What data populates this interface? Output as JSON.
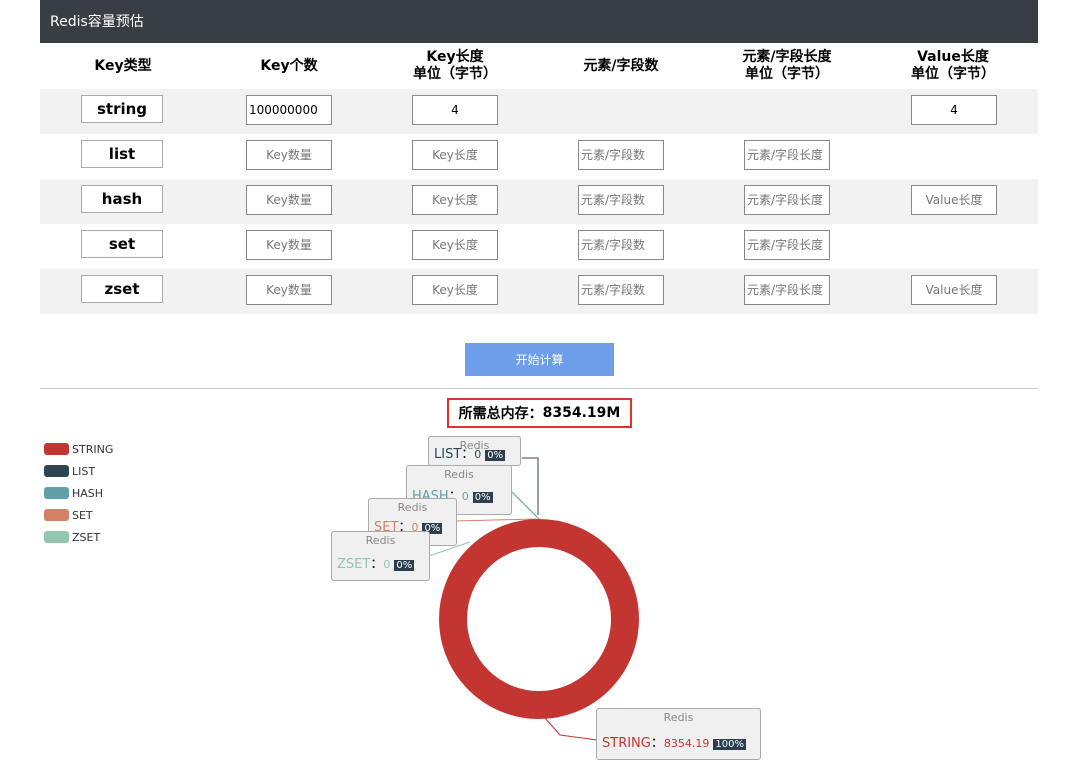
{
  "app": {
    "title": "Redis容量预估"
  },
  "headers": [
    "Key类型",
    "Key个数",
    "Key长度\n单位（字节）",
    "元素/字段数",
    "元素/字段长度\n单位（字节）",
    "Value长度\n单位（字节）"
  ],
  "rows": [
    {
      "type": "string",
      "key_count": "100000000",
      "key_length": "4",
      "value_length": "4"
    },
    {
      "type": "list",
      "key_count": "",
      "key_length": "",
      "element_count": "",
      "element_length": ""
    },
    {
      "type": "hash",
      "key_count": "",
      "key_length": "",
      "element_count": "",
      "element_length": "",
      "value_length": ""
    },
    {
      "type": "set",
      "key_count": "",
      "key_length": "",
      "element_count": "",
      "element_length": ""
    },
    {
      "type": "zset",
      "key_count": "",
      "key_length": "",
      "element_count": "",
      "element_length": "",
      "value_length": ""
    }
  ],
  "placeholders": {
    "key_count": "Key数量",
    "key_length": "Key长度",
    "element_count": "元素/字段数",
    "element_length": "元素/字段长度",
    "value_length": "Value长度"
  },
  "button": {
    "label": "开始计算"
  },
  "result": {
    "label": "所需总内存：",
    "value": "8354.19M"
  },
  "chart_data": {
    "type": "pie",
    "categories": [
      "STRING",
      "LIST",
      "HASH",
      "SET",
      "ZSET"
    ],
    "values": [
      8354.19,
      0,
      0,
      0,
      0
    ],
    "percents": [
      "100%",
      "0%",
      "0%",
      "0%",
      "0%"
    ],
    "colors": [
      "#c23531",
      "#2f4554",
      "#61a0a8",
      "#d48265",
      "#91c7ae"
    ],
    "tooltip_title": "Redis",
    "legend_position": "left",
    "donut": true
  }
}
